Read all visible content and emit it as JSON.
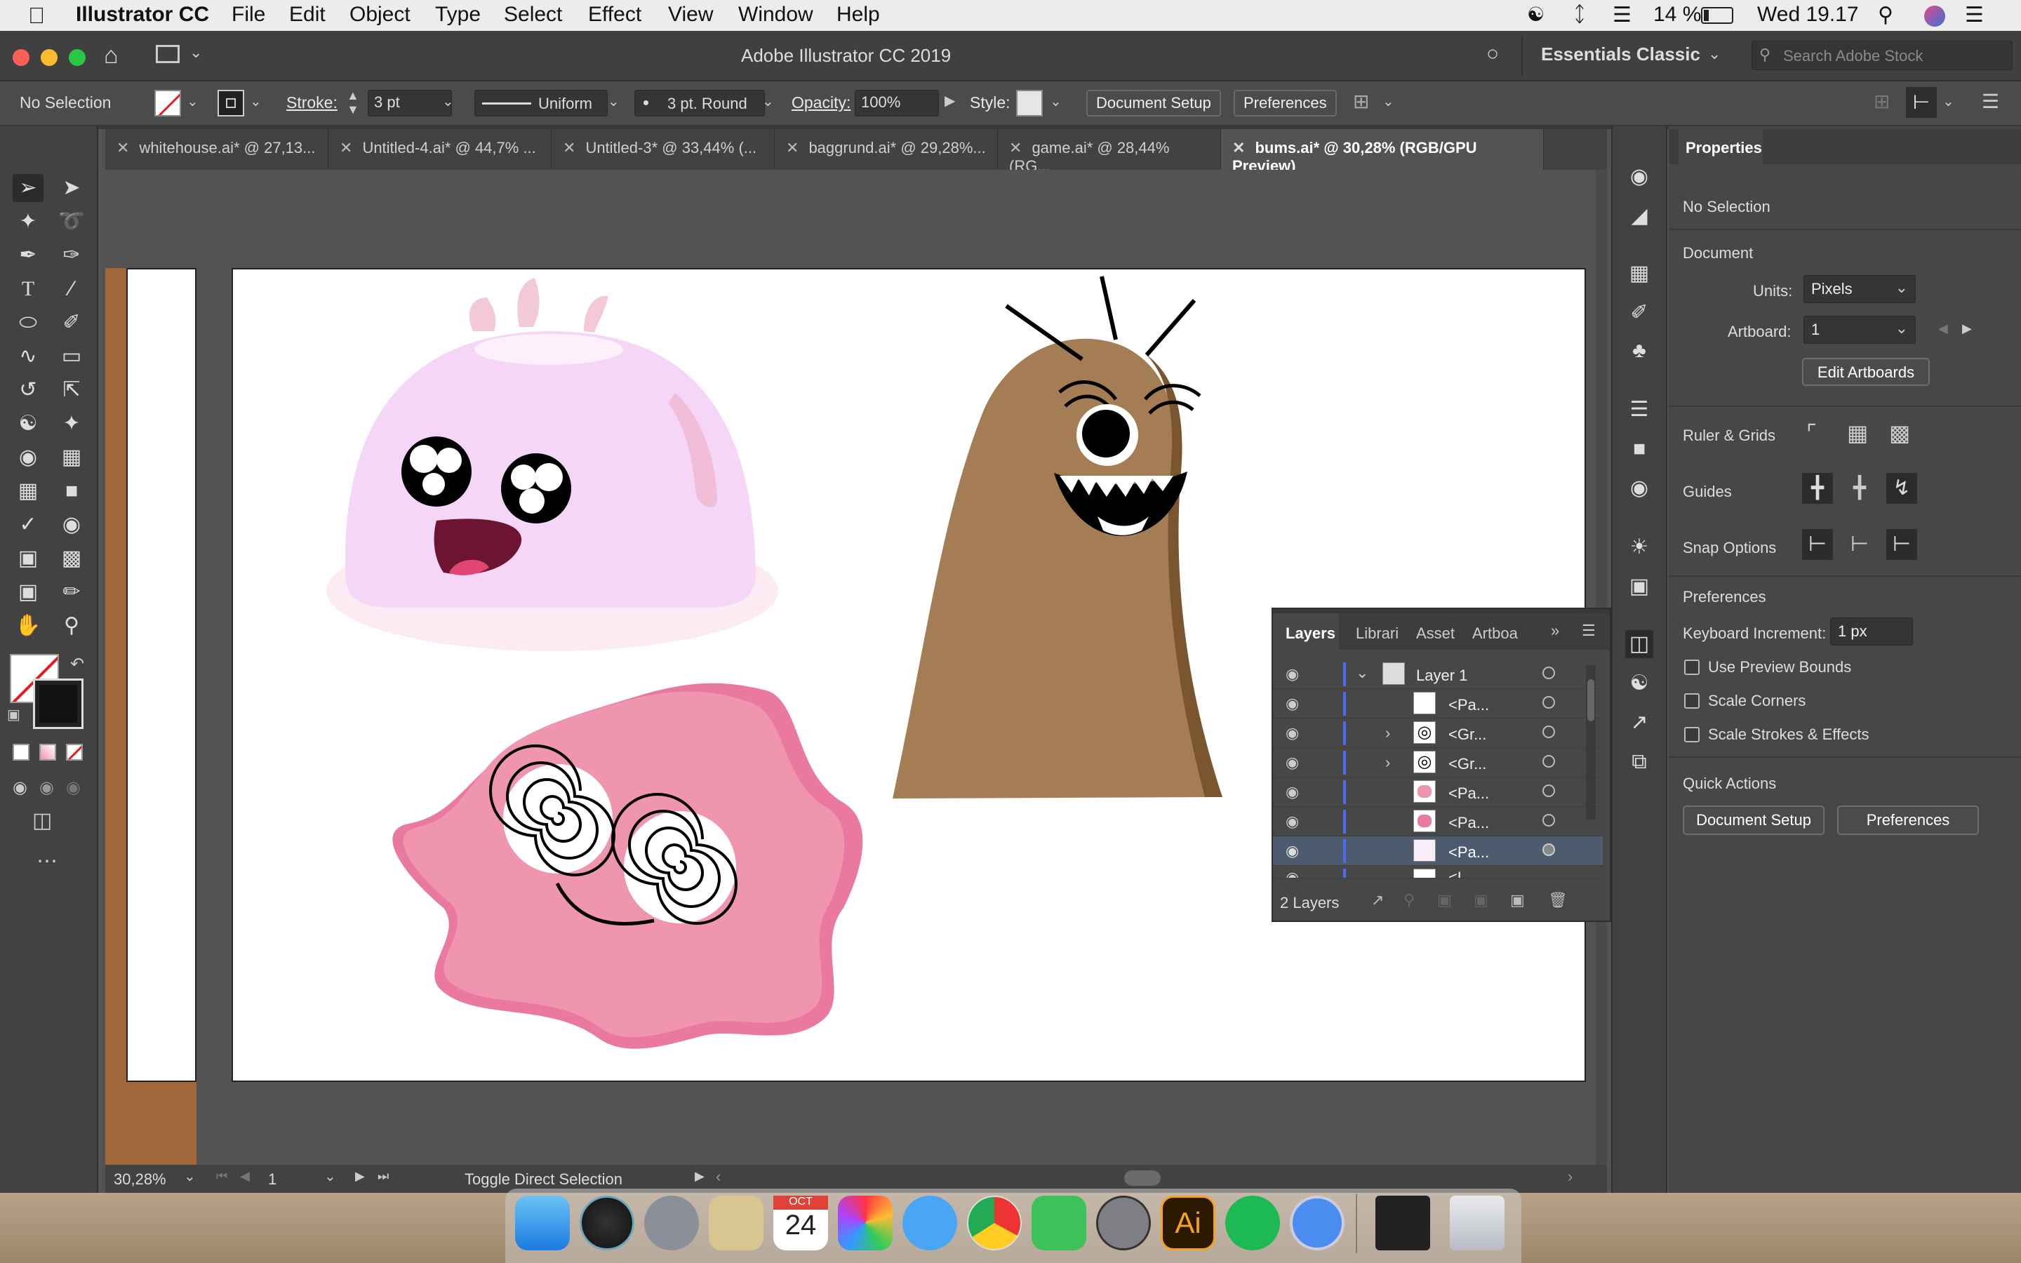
{
  "menubar": {
    "app_name": "Illustrator CC",
    "items": [
      "File",
      "Edit",
      "Object",
      "Type",
      "Select",
      "Effect",
      "View",
      "Window",
      "Help"
    ],
    "battery": "14 %",
    "clock": "Wed 19.17"
  },
  "titlebar": {
    "title": "Adobe Illustrator CC 2019",
    "workspace": "Essentials Classic",
    "search_placeholder": "Search Adobe Stock"
  },
  "control": {
    "selection": "No Selection",
    "stroke_label": "Stroke:",
    "stroke_value": "3 pt",
    "profile": "Uniform",
    "brush": "3 pt. Round",
    "opacity_label": "Opacity:",
    "opacity_value": "100%",
    "style_label": "Style:",
    "doc_setup": "Document Setup",
    "preferences": "Preferences"
  },
  "tabs": [
    {
      "label": "whitehouse.ai* @ 27,13..."
    },
    {
      "label": "Untitled-4.ai* @ 44,7% ..."
    },
    {
      "label": "Untitled-3* @ 33,44% (..."
    },
    {
      "label": "baggrund.ai* @ 29,28%..."
    },
    {
      "label": "game.ai* @ 28,44% (RG..."
    },
    {
      "label": "bums.ai* @ 30,28% (RGB/GPU Preview)"
    }
  ],
  "properties": {
    "tab": "Properties",
    "selection": "No Selection",
    "document": "Document",
    "units_label": "Units:",
    "units_value": "Pixels",
    "artboard_label": "Artboard:",
    "artboard_value": "1",
    "edit_artboards": "Edit Artboards",
    "ruler_grids": "Ruler & Grids",
    "guides": "Guides",
    "snap_options": "Snap Options",
    "preferences": "Preferences",
    "keyboard_increment_label": "Keyboard Increment:",
    "keyboard_increment_value": "1 px",
    "use_preview_bounds": "Use Preview Bounds",
    "scale_corners": "Scale Corners",
    "scale_strokes": "Scale Strokes & Effects",
    "quick_actions": "Quick Actions",
    "qa_doc_setup": "Document Setup",
    "qa_preferences": "Preferences"
  },
  "layers": {
    "tabs": [
      "Layers",
      "Librari",
      "Asset",
      "Artboa"
    ],
    "layer_name": "Layer 1",
    "rows": [
      "<Pa...",
      "<Gr...",
      "<Gr...",
      "<Pa...",
      "<Pa...",
      "<Pa...",
      "<L..."
    ],
    "count": "2 Layers"
  },
  "status": {
    "zoom": "30,28%",
    "artboard": "1",
    "message": "Toggle Direct Selection"
  },
  "dock": {
    "calendar_month": "OCT",
    "calendar_day": "24",
    "ai_label": "Ai"
  },
  "colors": {
    "pink_blob": "#ef95b0",
    "jelly": "#f6d6f7",
    "brown": "#a57d54",
    "accent": "#2f7dd6"
  }
}
